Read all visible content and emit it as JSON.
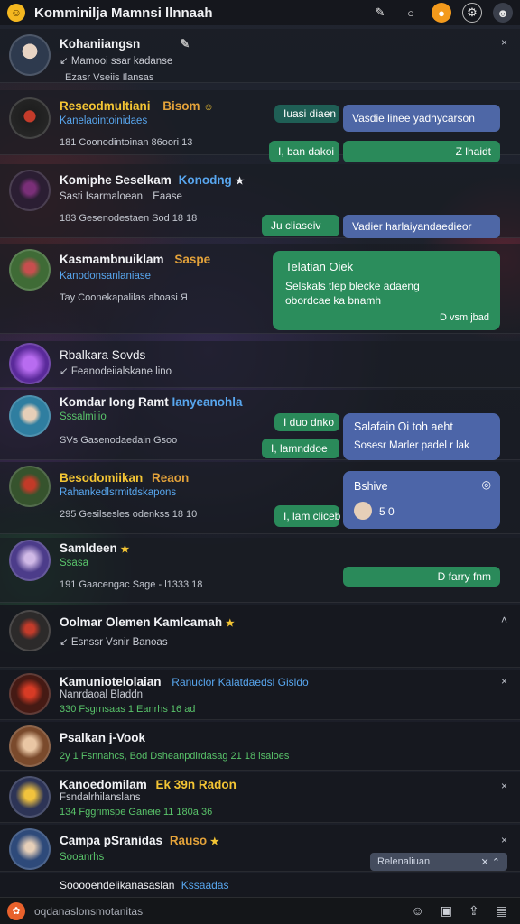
{
  "app": {
    "title": "Komminilja Mamnsi llnnaah",
    "icons": [
      "app-icon",
      "pen-icon",
      "search-icon",
      "bell-icon",
      "settings-icon",
      "profile-avatar-icon"
    ]
  },
  "rows": [
    {
      "name": "Kohaniiangsn",
      "name_suffix": "✎",
      "sub": "↙ Mamooi ssar kadanse",
      "meta": "Ezasr Vseiis Ilansas",
      "close": "×"
    },
    {
      "name": "Reseodmultiani",
      "name_tag": "Bisom",
      "sub": "Kanelaointoinidaes",
      "meta": "181 Coonodintoinan 86oori 13",
      "bubbles": [
        {
          "text": "Iuasi diaen"
        },
        {
          "text": "Vasdie linee yadhycarson"
        },
        {
          "text": "I, ban dakoi"
        },
        {
          "text": "Z lhaidt"
        }
      ]
    },
    {
      "name": "Komiphe Seselkam",
      "name_tag": "Konodng",
      "sub": "Sasti Isarmaloean",
      "sub_tag": "Eaase",
      "meta": "183 Gesenodestaen Sod 18 18",
      "bubbles": [
        {
          "text": "Ju cliaseiv"
        },
        {
          "text": "Vadier harlaiyandaedieor"
        }
      ]
    },
    {
      "name": "Kasmambnuiklam",
      "name_tag": "Saspe",
      "sub": "Kanodonsanlaniase",
      "meta": "Tay Coonekapalilas aboasi Я",
      "card": {
        "title": "Telatian Oiek",
        "body1": "Selskals tlep blecke adaeng",
        "body2": "obordcae ka bnamh",
        "foot": "D vsm jbad"
      }
    },
    {
      "name": "Rbalkara Sovds",
      "sub": "↙ Feanodeiialskane lino"
    },
    {
      "name": "Komdar Iong Ramt",
      "name_tag": "Ianyeanohla",
      "sub": "Sssalmilio",
      "meta": "SVs Gasenodaedain Gsoo",
      "bubbles": [
        {
          "text": "I duo dnko"
        },
        {
          "text": "I, lamnddoe"
        }
      ],
      "card": {
        "line1": "Salafain Oi toh aeht",
        "line2": "Sosesr Marler padel r lak"
      }
    },
    {
      "name": "Besodomiikan",
      "name_tag": "Reaon",
      "sub": "Rahankedlsrmitdskapons",
      "meta": "295 Gesilsesles odenkss 18 10",
      "bubbles": [
        {
          "text": "I, lam cliceb"
        },
        {
          "text": "Bshive"
        },
        {
          "text": "D farry fnm"
        }
      ],
      "card_value": "5 0"
    },
    {
      "name": "Samldeen",
      "sub": "Ssasa",
      "meta": "191 Gaacengac Sage - l1333 18"
    },
    {
      "name": "Oolmar Olemen Kamlcamah",
      "sub": "↙ Esnssr Vsnir Banoas"
    },
    {
      "name": "Kamuniotelolaian",
      "name_tag": "Ranuclor Kalatdaedsl Gisldo",
      "sub": "Nanrdaoal Bladdn",
      "meta": "330 Fsgrnsaas 1 Eanrhs 16 ad",
      "close": "×"
    },
    {
      "name": "Psalkan j-Vook",
      "meta": "2y 1 Fsnnahcs, Bod Dsheanpdirdasag 21 18 lsaloes"
    },
    {
      "name": "Kanoedomilam",
      "name_tag": "Ek 39n Radon",
      "sub": "Fsndalrhilanslans",
      "meta": "134 Fggrimspe Ganeie 11 180a 36",
      "close": "×"
    },
    {
      "name": "Campa pSranidas",
      "name_tag": "Rauso",
      "sub": "Sooanrhs",
      "close": "×"
    },
    {
      "name": "Sooooendelikanasaslan",
      "name_tag": "Kssaadas"
    }
  ],
  "footer_pill": "Relenaliuan",
  "bottombar": {
    "placeholder": "oqdanaslonsmotanitas",
    "tools": [
      "emoji-icon",
      "sticker-icon",
      "attach-icon",
      "more-icon"
    ]
  },
  "colors": {
    "accent_green": "#2a8a5a",
    "accent_blue": "#4e67a6",
    "accent_teal": "#1f5f55",
    "link_blue": "#58a6ee",
    "highlight_yellow": "#f4c534"
  }
}
